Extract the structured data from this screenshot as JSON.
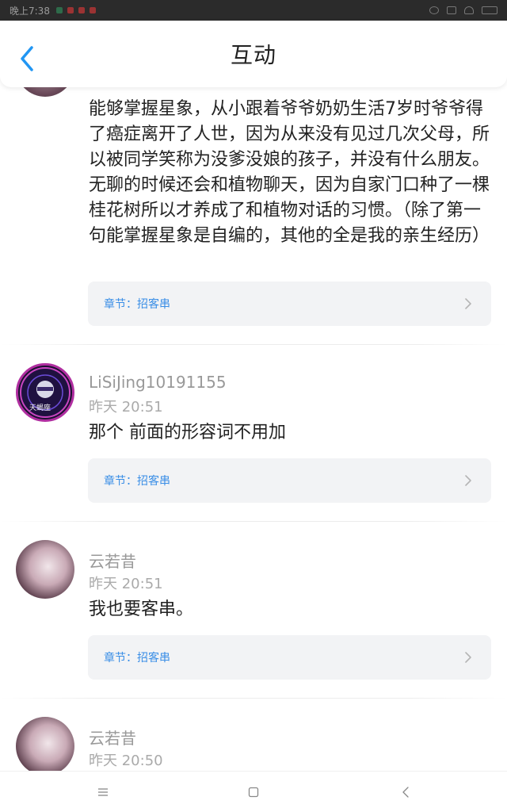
{
  "status_bar": {
    "time": "晚上7:38",
    "indicator_colors": [
      "#2e6b4a",
      "#9b3333",
      "#9b3333",
      "#9b3333"
    ]
  },
  "header": {
    "title": "互动",
    "back_icon": "chevron-left-icon",
    "accent_color": "#2196f3"
  },
  "comments": [
    {
      "avatar": "anime-avatar",
      "username": "",
      "time": "",
      "text": "能够掌握星象，从小跟着爷爷奶奶生活7岁时爷爷得了癌症离开了人世，因为从来没有见过几次父母，所以被同学笑称为没爹没娘的孩子，并没有什么朋友。无聊的时候还会和植物聊天，因为自家门口种了一棵桂花树所以才养成了和植物对话的习惯。（除了第一句能掌握星象是自编的，其他的全是我的亲生经历）",
      "chapter": "章节：招客串"
    },
    {
      "avatar": "zodiac-avatar",
      "avatar_text": "天蝎座",
      "username": "LiSiJing10191155",
      "time": "昨天 20:51",
      "text": "那个 前面的形容词不用加",
      "chapter": "章节：招客串"
    },
    {
      "avatar": "anime-avatar",
      "username": "云若昔",
      "time": "昨天 20:51",
      "text": "我也要客串。",
      "chapter": "章节：招客串"
    },
    {
      "avatar": "anime-avatar",
      "username": "云若昔",
      "time": "昨天 20:50",
      "text": "",
      "chapter": ""
    }
  ],
  "nav_bar": {
    "menu_icon": "menu-icon",
    "home_icon": "home-square-icon",
    "back_icon": "back-triangle-icon"
  }
}
